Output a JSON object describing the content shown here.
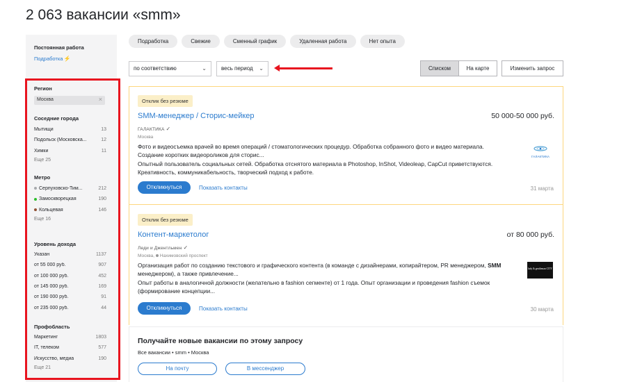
{
  "page_title": "2 063 вакансии «smm»",
  "sidebar": {
    "job_type_label": "Постоянная работа",
    "job_type_link": "Подработка",
    "filters": {
      "region": {
        "heading": "Регион",
        "value": "Москва"
      },
      "nearby": {
        "heading": "Соседние города",
        "items": [
          {
            "name": "Мытищи",
            "count": "13"
          },
          {
            "name": "Подольск (Московска...",
            "count": "12"
          },
          {
            "name": "Химки",
            "count": "11"
          }
        ],
        "more": "Еще 25"
      },
      "metro": {
        "heading": "Метро",
        "items": [
          {
            "name": "Серпуховско-Тим...",
            "count": "212",
            "color": "#a7a9ac"
          },
          {
            "name": "Замоскворецкая",
            "count": "190",
            "color": "#2dbe2c"
          },
          {
            "name": "Кольцевая",
            "count": "146",
            "color": "#915133"
          }
        ],
        "more": "Еще 16"
      },
      "income": {
        "heading": "Уровень дохода",
        "items": [
          {
            "name": "Указан",
            "count": "1137"
          },
          {
            "name": "от 55 000 руб.",
            "count": "907"
          },
          {
            "name": "от 100 000 руб.",
            "count": "452"
          },
          {
            "name": "от 145 000 руб.",
            "count": "169"
          },
          {
            "name": "от 190 000 руб.",
            "count": "91"
          },
          {
            "name": "от 235 000 руб.",
            "count": "44"
          }
        ]
      },
      "profarea": {
        "heading": "Профобласть",
        "items": [
          {
            "name": "Маркетинг",
            "count": "1803"
          },
          {
            "name": "IT, телеком",
            "count": "577"
          },
          {
            "name": "Искусство, медиа",
            "count": "190"
          }
        ],
        "more": "Еще 21"
      }
    }
  },
  "chips": [
    "Подработка",
    "Свежие",
    "Сменный график",
    "Удаленная работа",
    "Нет опыта"
  ],
  "controls": {
    "sort": "по соответствию",
    "period": "весь период",
    "view_list": "Списком",
    "view_map": "На карте",
    "change_query": "Изменить запрос"
  },
  "vacancies": [
    {
      "badge": "Отклик без резюме",
      "title": "SMM-менеджер / Сторис-мейкер",
      "salary": "50 000-50 000 руб.",
      "company": "ГАЛАКТИКА",
      "city": "Москва",
      "metro": "",
      "desc": [
        "Фото и видеосъемка врачей во время операций / стоматологических процедур. Обработка собранного фото и видео материала.",
        "Создание коротких видеороликов для сторис...",
        "Опытный пользователь социальных сетей. Обработка отснятого материала в Photoshop, InShot, Videoleap, CapCut приветствуются.",
        "Креативность, коммуникабельность, творческий подход к работе."
      ],
      "logo_text": "ГАЛАКТИКА",
      "respond": "Откликнуться",
      "contacts": "Показать контакты",
      "date": "31 марта"
    },
    {
      "badge": "Отклик без резюме",
      "title": "Контент-маркетолог",
      "salary": "от 80 000 руб.",
      "company": "Леди и Джентльмен",
      "city": "Москва,",
      "metro": "Нахимовский проспект",
      "desc": [
        "Организация работ по созданию текстового и графического контента (в команде с дизайнерами, копирайтером, PR менеджером, ",
        "менеджером), а также привлечение...",
        "Опыт работы в аналогичной должности (желательно в fashion сегменте) от 1 года. Опыт организации и проведения fashion съемок",
        "(формирование концепции..."
      ],
      "desc_bold": "SMM",
      "logo_text": "lady & gentleman CITY",
      "respond": "Откликнуться",
      "contacts": "Показать контакты",
      "date": "30 марта"
    }
  ],
  "subscribe": {
    "title": "Получайте новые вакансии по этому запросу",
    "text": "Все вакансии • smm • Москва",
    "email_btn": "На почту",
    "messenger_btn": "В мессенджер"
  },
  "colors": {
    "accent": "#2b7bce",
    "highlight": "#e8141f",
    "badge_bg": "#fbefc8",
    "card_border": "#fdd77d"
  }
}
